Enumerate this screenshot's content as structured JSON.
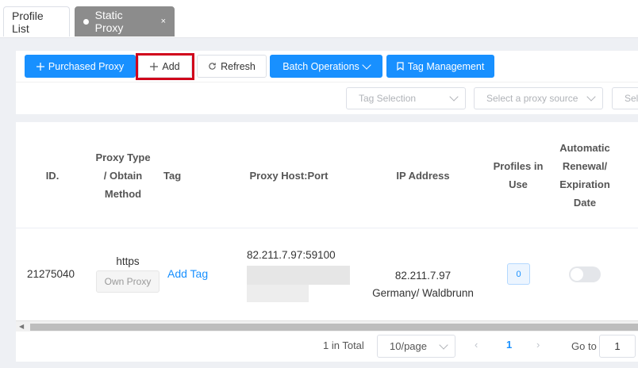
{
  "tabs": [
    {
      "label": "Profile List",
      "active": false
    },
    {
      "label": "Static Proxy",
      "active": true,
      "close": "×"
    }
  ],
  "toolbar": {
    "purchased_label": "Purchased Proxy",
    "add_label": "Add",
    "refresh_label": "Refresh",
    "batch_label": "Batch Operations",
    "tag_mgmt_label": "Tag Management"
  },
  "filters": {
    "tag_placeholder": "Tag Selection",
    "source_placeholder": "Select a proxy source",
    "third_placeholder": "Sel"
  },
  "table": {
    "headers": {
      "id": "ID.",
      "type": "Proxy Type / Obtain Method",
      "tag": "Tag",
      "host": "Proxy Host:Port",
      "ip": "IP Address",
      "profiles": "Profiles in Use",
      "renewal": "Automatic Renewal/ Expiration Date"
    },
    "rows": [
      {
        "id": "21275040",
        "protocol": "https",
        "method": "Own Proxy",
        "tag_action": "Add Tag",
        "host": "82.211.7.97:59100",
        "ip": "82.211.7.97",
        "location": "Germany/ Waldbrunn",
        "profiles": "0",
        "auto_renewal": false
      }
    ]
  },
  "pagination": {
    "total": "1 in Total",
    "page_size": "10/page",
    "prev": "‹",
    "current": "1",
    "next": "›",
    "goto_label": "Go to",
    "goto_value": "1"
  },
  "colors": {
    "primary": "#1890ff",
    "highlight": "#d0021b",
    "active_tab": "#8c8c8c"
  }
}
